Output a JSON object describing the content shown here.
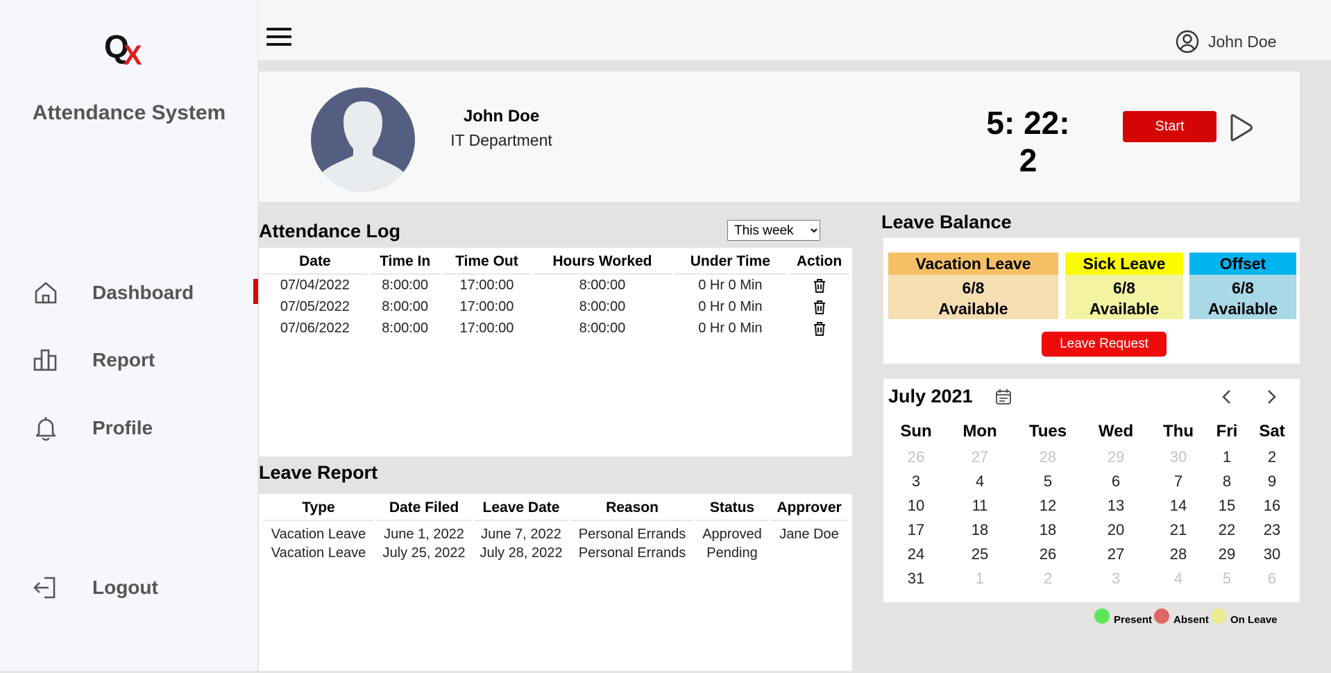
{
  "app": {
    "logo_q": "Q",
    "logo_x": "X",
    "title": "Attendance System"
  },
  "sidebar": {
    "items": [
      {
        "label": "Dashboard",
        "icon": "home-icon"
      },
      {
        "label": "Report",
        "icon": "bar-chart-icon"
      },
      {
        "label": "Profile",
        "icon": "bell-icon"
      }
    ],
    "logout_label": "Logout"
  },
  "header": {
    "menu_icon": "hamburger-icon",
    "user_icon": "user-circle-icon",
    "user_name": "John Doe"
  },
  "profile": {
    "name": "John Doe",
    "department": "IT Department",
    "timer": "5: 22: 2",
    "start_label": "Start"
  },
  "attendance_log": {
    "title": "Attendance Log",
    "filter_selected": "This week",
    "columns": [
      "Date",
      "Time In",
      "Time Out",
      "Hours Worked",
      "Under Time",
      "Action"
    ],
    "rows": [
      {
        "date": "07/04/2022",
        "time_in": "8:00:00",
        "time_out": "17:00:00",
        "hours": "8:00:00",
        "under": "0 Hr 0 Min"
      },
      {
        "date": "07/05/2022",
        "time_in": "8:00:00",
        "time_out": "17:00:00",
        "hours": "8:00:00",
        "under": "0 Hr 0 Min"
      },
      {
        "date": "07/06/2022",
        "time_in": "8:00:00",
        "time_out": "17:00:00",
        "hours": "8:00:00",
        "under": "0 Hr 0 Min"
      }
    ]
  },
  "leave_report": {
    "title": "Leave Report",
    "columns": [
      "Type",
      "Date Filed",
      "Leave Date",
      "Reason",
      "Status",
      "Approver"
    ],
    "rows": [
      {
        "type": "Vacation Leave",
        "filed": "June 1, 2022",
        "leave_date": "June 7, 2022",
        "reason": "Personal Errands",
        "status": "Approved",
        "approver": "Jane Doe"
      },
      {
        "type": "Vacation Leave",
        "filed": "July 25, 2022",
        "leave_date": "July 28, 2022",
        "reason": "Personal Errands",
        "status": "Pending",
        "approver": ""
      }
    ]
  },
  "leave_balance": {
    "title": "Leave Balance",
    "boxes": [
      {
        "label": "Vacation Leave",
        "count": "6/8",
        "available": "Available",
        "head_color": "#f5c065",
        "body_color": "#f4deb2"
      },
      {
        "label": "Sick Leave",
        "count": "6/8",
        "available": "Available",
        "head_color": "#fcfb00",
        "body_color": "#f3f3a2"
      },
      {
        "label": "Offset",
        "count": "6/8",
        "available": "Available",
        "head_color": "#00b4f0",
        "body_color": "#a9d8e6"
      }
    ],
    "request_label": "Leave Request"
  },
  "calendar": {
    "month": "July 2021",
    "weekdays": [
      "Sun",
      "Mon",
      "Tues",
      "Wed",
      "Thu",
      "Fri",
      "Sat"
    ],
    "weeks": [
      [
        "26",
        "27",
        "28",
        "29",
        "30",
        "1",
        "2"
      ],
      [
        "3",
        "4",
        "5",
        "6",
        "7",
        "8",
        "9"
      ],
      [
        "10",
        "11",
        "12",
        "13",
        "14",
        "15",
        "16"
      ],
      [
        "17",
        "18",
        "18",
        "20",
        "21",
        "22",
        "23"
      ],
      [
        "24",
        "25",
        "26",
        "27",
        "28",
        "29",
        "30"
      ],
      [
        "31",
        "1",
        "2",
        "3",
        "4",
        "5",
        "6"
      ]
    ],
    "muted": [
      [
        true,
        true,
        true,
        true,
        true,
        false,
        false
      ],
      [
        false,
        false,
        false,
        false,
        false,
        false,
        false
      ],
      [
        false,
        false,
        false,
        false,
        false,
        false,
        false
      ],
      [
        false,
        false,
        false,
        false,
        false,
        false,
        false
      ],
      [
        false,
        false,
        false,
        false,
        false,
        false,
        false
      ],
      [
        false,
        true,
        true,
        true,
        true,
        true,
        true
      ]
    ]
  },
  "legend": [
    {
      "label": "Present",
      "color": "#5ce65c"
    },
    {
      "label": "Absent",
      "color": "#e06666"
    },
    {
      "label": "On Leave",
      "color": "#ecec8c"
    }
  ],
  "colors": {
    "accent_red": "#d60505",
    "sidebar_bg": "#f6f7fc",
    "avatar_bg": "#545e80"
  }
}
